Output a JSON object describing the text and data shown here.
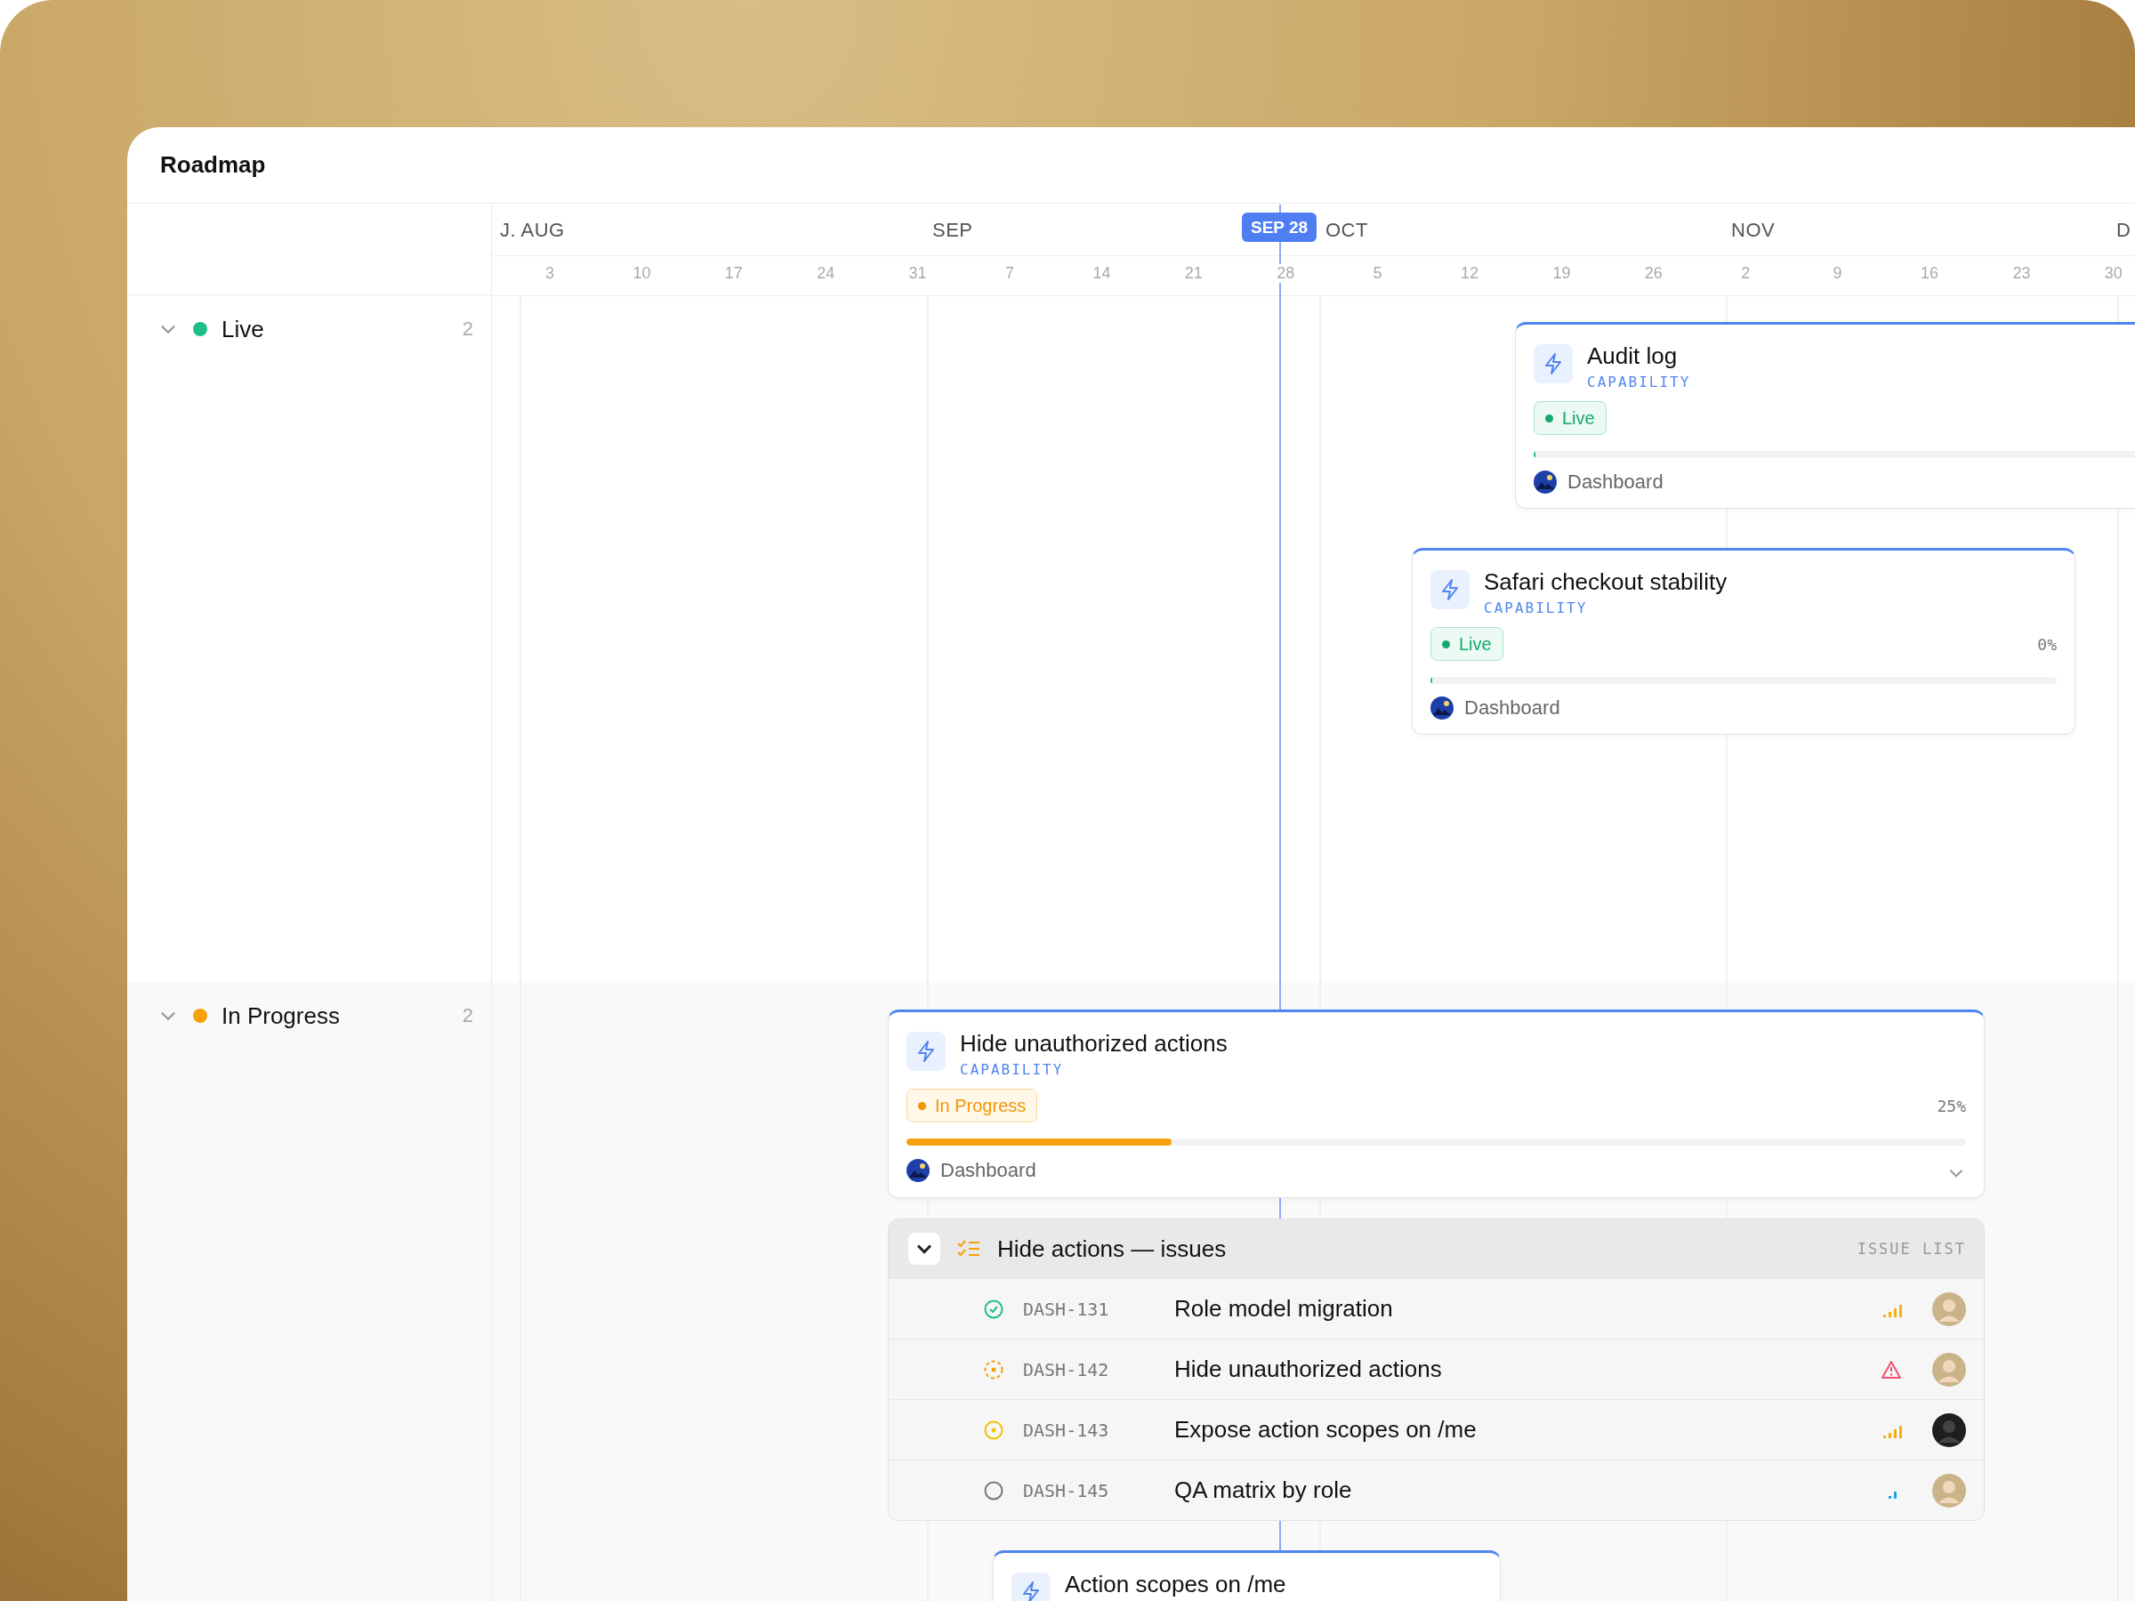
{
  "window": {
    "title": "Roadmap"
  },
  "timeline": {
    "months": [
      "J. AUG",
      "SEP",
      "OCT",
      "NOV",
      "D"
    ],
    "today": "SEP 28",
    "days": [
      "3",
      "10",
      "17",
      "24",
      "31",
      "7",
      "14",
      "21",
      "28",
      "5",
      "12",
      "19",
      "26",
      "2",
      "9",
      "16",
      "23",
      "30"
    ]
  },
  "lanes": [
    {
      "name": "Live",
      "color": "#1dbf86",
      "count": "2",
      "expanded": true
    },
    {
      "name": "In Progress",
      "color": "#f5a00c",
      "count": "2",
      "expanded": true
    }
  ],
  "cards": [
    {
      "title": "Audit log",
      "type": "CAPABILITY",
      "status": {
        "label": "Live",
        "kind": "live"
      },
      "level": 0,
      "product": "Dashboard"
    },
    {
      "title": "Safari checkout stability",
      "type": "CAPABILITY",
      "status": {
        "label": "Live",
        "kind": "live"
      },
      "percent": "0%",
      "level": 0,
      "product": "Dashboard"
    },
    {
      "title": "Hide unauthorized actions",
      "type": "CAPABILITY",
      "status": {
        "label": "In Progress",
        "kind": "in_progress"
      },
      "percent": "25%",
      "level": 0.25,
      "product": "Dashboard",
      "issue_list": {
        "title": "Hide actions — issues",
        "label": "ISSUE LIST",
        "expanded": true,
        "issues": [
          {
            "id": "DASH-131",
            "title": "Role model migration",
            "status": {
              "kind": "done"
            },
            "priority": {
              "kind": "medium"
            },
            "avatar": {
              "kind": "light"
            }
          },
          {
            "id": "DASH-142",
            "title": "Hide unauthorized actions",
            "status": {
              "kind": "started"
            },
            "priority": {
              "kind": "urgent"
            },
            "avatar": {
              "kind": "light"
            }
          },
          {
            "id": "DASH-143",
            "title": "Expose action scopes on /me",
            "status": {
              "kind": "review"
            },
            "priority": {
              "kind": "medium"
            },
            "avatar": {
              "kind": "dark"
            }
          },
          {
            "id": "DASH-145",
            "title": "QA matrix by role",
            "status": {
              "kind": "todo"
            },
            "priority": {
              "kind": "low"
            },
            "avatar": {
              "kind": "light"
            }
          }
        ]
      }
    },
    {
      "title": "Action scopes on /me"
    }
  ]
}
